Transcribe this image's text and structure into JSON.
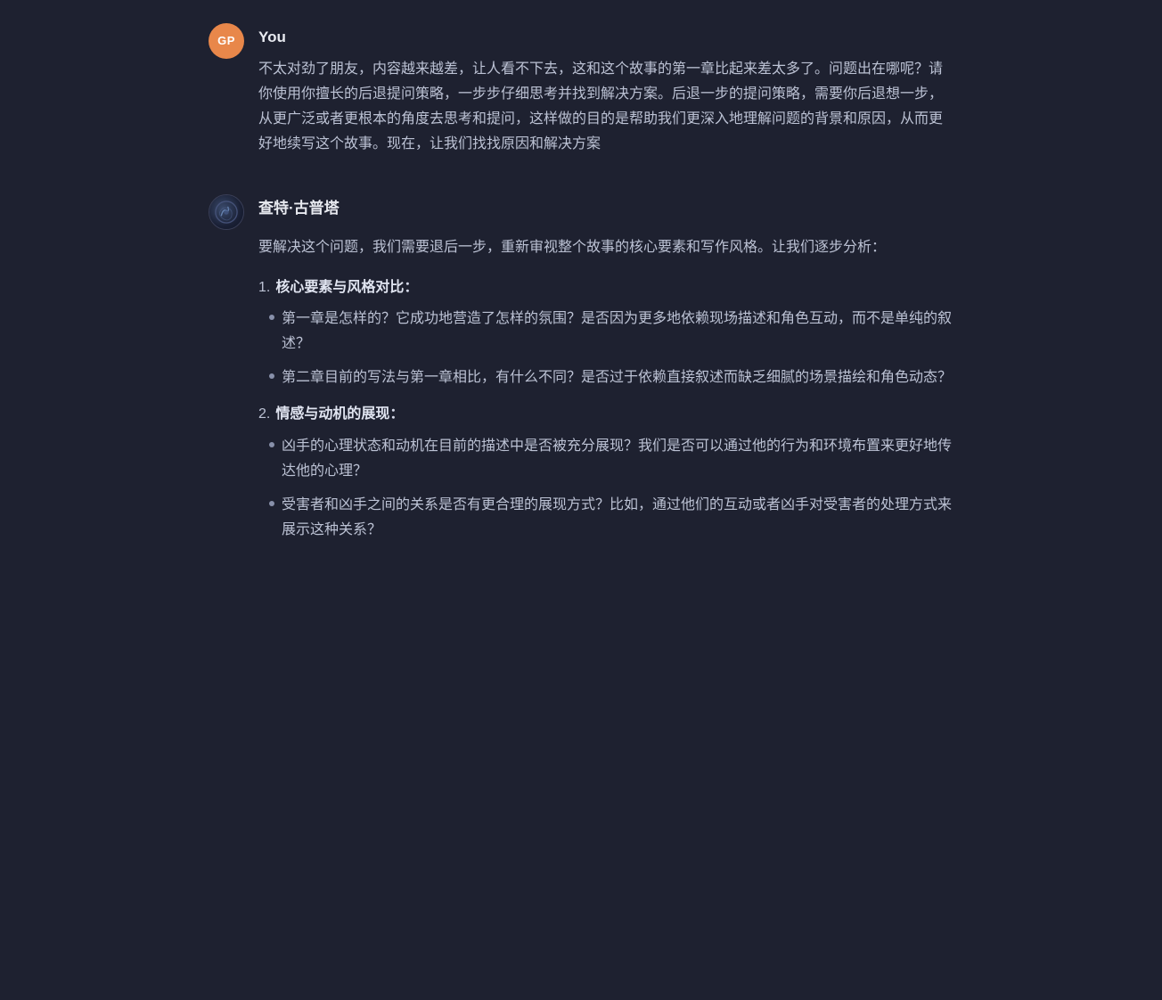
{
  "colors": {
    "background": "#1e2130",
    "text": "#bcc2d4",
    "name": "#e8eaf0",
    "accent": "#e8874a"
  },
  "messages": [
    {
      "id": "user-message",
      "sender": "You",
      "avatar_initials": "GP",
      "avatar_type": "user",
      "text": "不太对劲了朋友，内容越来越差，让人看不下去，这和这个故事的第一章比起来差太多了。问题出在哪呢？请你使用你擅长的后退提问策略，一步步仔细思考并找到解决方案。后退一步的提问策略，需要你后退想一步，从更广泛或者更根本的角度去思考和提问，这样做的目的是帮助我们更深入地理解问题的背景和原因，从而更好地续写这个故事。现在，让我们找找原因和解决方案"
    },
    {
      "id": "ai-message",
      "sender": "查特·古普塔",
      "avatar_type": "ai",
      "intro": "要解决这个问题，我们需要退后一步，重新审视整个故事的核心要素和写作风格。让我们逐步分析：",
      "sections": [
        {
          "number": "1.",
          "title": "核心要素与风格对比",
          "colon": "：",
          "bullets": [
            "第一章是怎样的？它成功地营造了怎样的氛围？是否因为更多地依赖现场描述和角色互动，而不是单纯的叙述？",
            "第二章目前的写法与第一章相比，有什么不同？是否过于依赖直接叙述而缺乏细腻的场景描绘和角色动态？"
          ]
        },
        {
          "number": "2.",
          "title": "情感与动机的展现",
          "colon": "：",
          "bullets": [
            "凶手的心理状态和动机在目前的描述中是否被充分展现？我们是否可以通过他的行为和环境布置来更好地传达他的心理？",
            "受害者和凶手之间的关系是否有更合理的展现方式？比如，通过他们的互动或者凶手对受害者的处理方式来展示这种关系？"
          ]
        }
      ]
    }
  ]
}
